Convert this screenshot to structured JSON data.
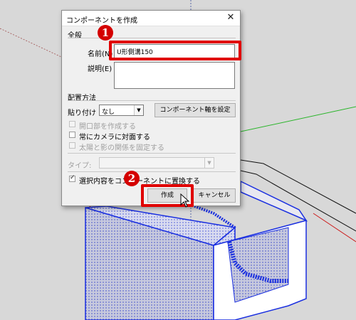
{
  "dialog": {
    "title": "コンポーネントを作成",
    "section_general": "全般",
    "name_label": "名前(N)",
    "name_value": "U形側溝150",
    "desc_label": "説明(E)",
    "desc_value": "",
    "section_placement": "配置方法",
    "paste_label": "貼り付け",
    "paste_value": "なし",
    "set_axes_button": "コンポーネント軸を設定",
    "cut_opening": "開口部を作成する",
    "always_face_camera": "常にカメラに対面する",
    "shadows_face_sun": "太陽と影の関係を固定する",
    "type_label": "タイプ:",
    "type_value": "",
    "replace_selection": "選択内容をコンポーネントに置換する",
    "create_button": "作成",
    "cancel_button": "キャンセル"
  },
  "markers": {
    "one": "1",
    "two": "2"
  },
  "colors": {
    "highlight": "#e00000",
    "marker": "#d40000",
    "model_blue": "#1a2fe0"
  }
}
